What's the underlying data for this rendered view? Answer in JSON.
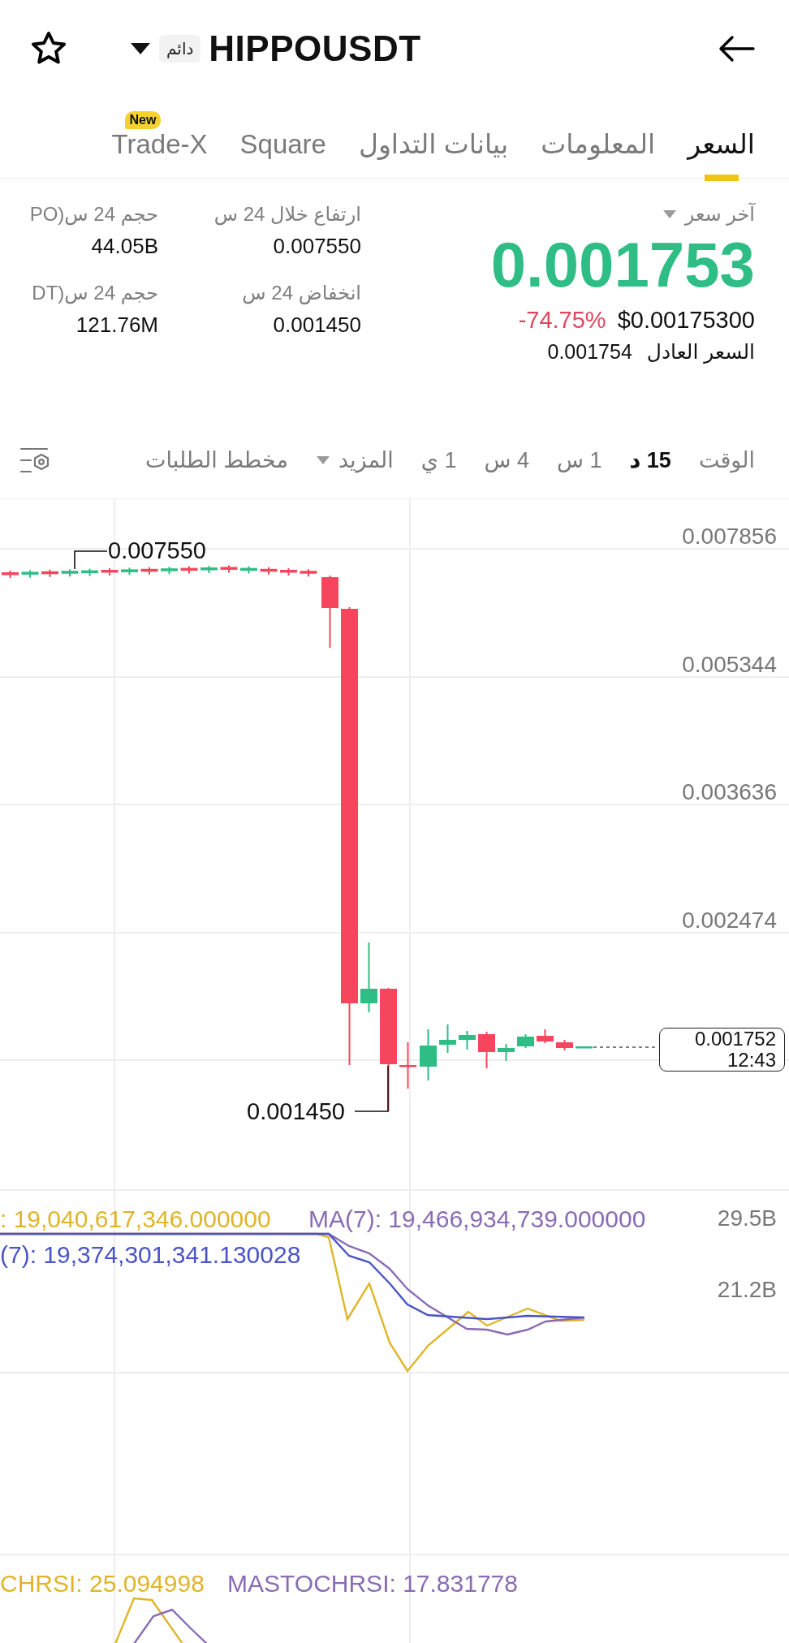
{
  "header": {
    "title": "HIPPOUSDT",
    "badge": "دائم"
  },
  "tabs": [
    {
      "label": "السعر",
      "selected": true
    },
    {
      "label": "المعلومات",
      "selected": false
    },
    {
      "label": "بيانات التداول",
      "selected": false
    },
    {
      "label": "Square",
      "selected": false
    },
    {
      "label": "Trade-X",
      "selected": false,
      "badge": "New"
    }
  ],
  "price": {
    "label": "آخر سعر",
    "last": "0.001753",
    "change": "-74.75%",
    "usd": "$0.00175300",
    "fair_label": "السعر العادل",
    "fair": "0.001754"
  },
  "stats": [
    {
      "label": "ارتفاع خلال 24 س",
      "value": "0.007550"
    },
    {
      "label": "حجم 24 س(PO",
      "value": "44.05B"
    },
    {
      "label": "انخفاض 24 س",
      "value": "0.001450"
    },
    {
      "label": "حجم 24 س(DT",
      "value": "121.76M"
    }
  ],
  "timebar": {
    "label": "الوقت",
    "intervals": [
      {
        "label": "15 د",
        "selected": true
      },
      {
        "label": "1 س",
        "selected": false
      },
      {
        "label": "4 س",
        "selected": false
      },
      {
        "label": "1 ي",
        "selected": false
      }
    ],
    "more": "المزيد",
    "depth": "مخطط الطلبات"
  },
  "chart": {
    "price_ticks": [
      "0.007856",
      "0.005344",
      "0.003636",
      "0.002474"
    ],
    "high_marker": "0.007550",
    "low_marker": "0.001450",
    "last_price": "0.001752",
    "countdown": "12:43"
  },
  "volume": {
    "labels": [
      {
        "text": "MA(7): 19,466,934,739.000000",
        "color": "#8a6cb4"
      },
      {
        "text": ": 19,040,617,346.000000",
        "color": "#e0b52a"
      },
      {
        "text": "(7): 19,374,301,341.130028",
        "color": "#4a54c6"
      }
    ],
    "ticks": [
      "29.5B",
      "21.2B"
    ]
  },
  "stoch": {
    "labels": [
      {
        "text": "MASTOCHRSI: 17.831778",
        "color": "#8a6cb4"
      },
      {
        "text": "CHRSI: 25.094998",
        "color": "#e0b52a"
      }
    ]
  }
}
